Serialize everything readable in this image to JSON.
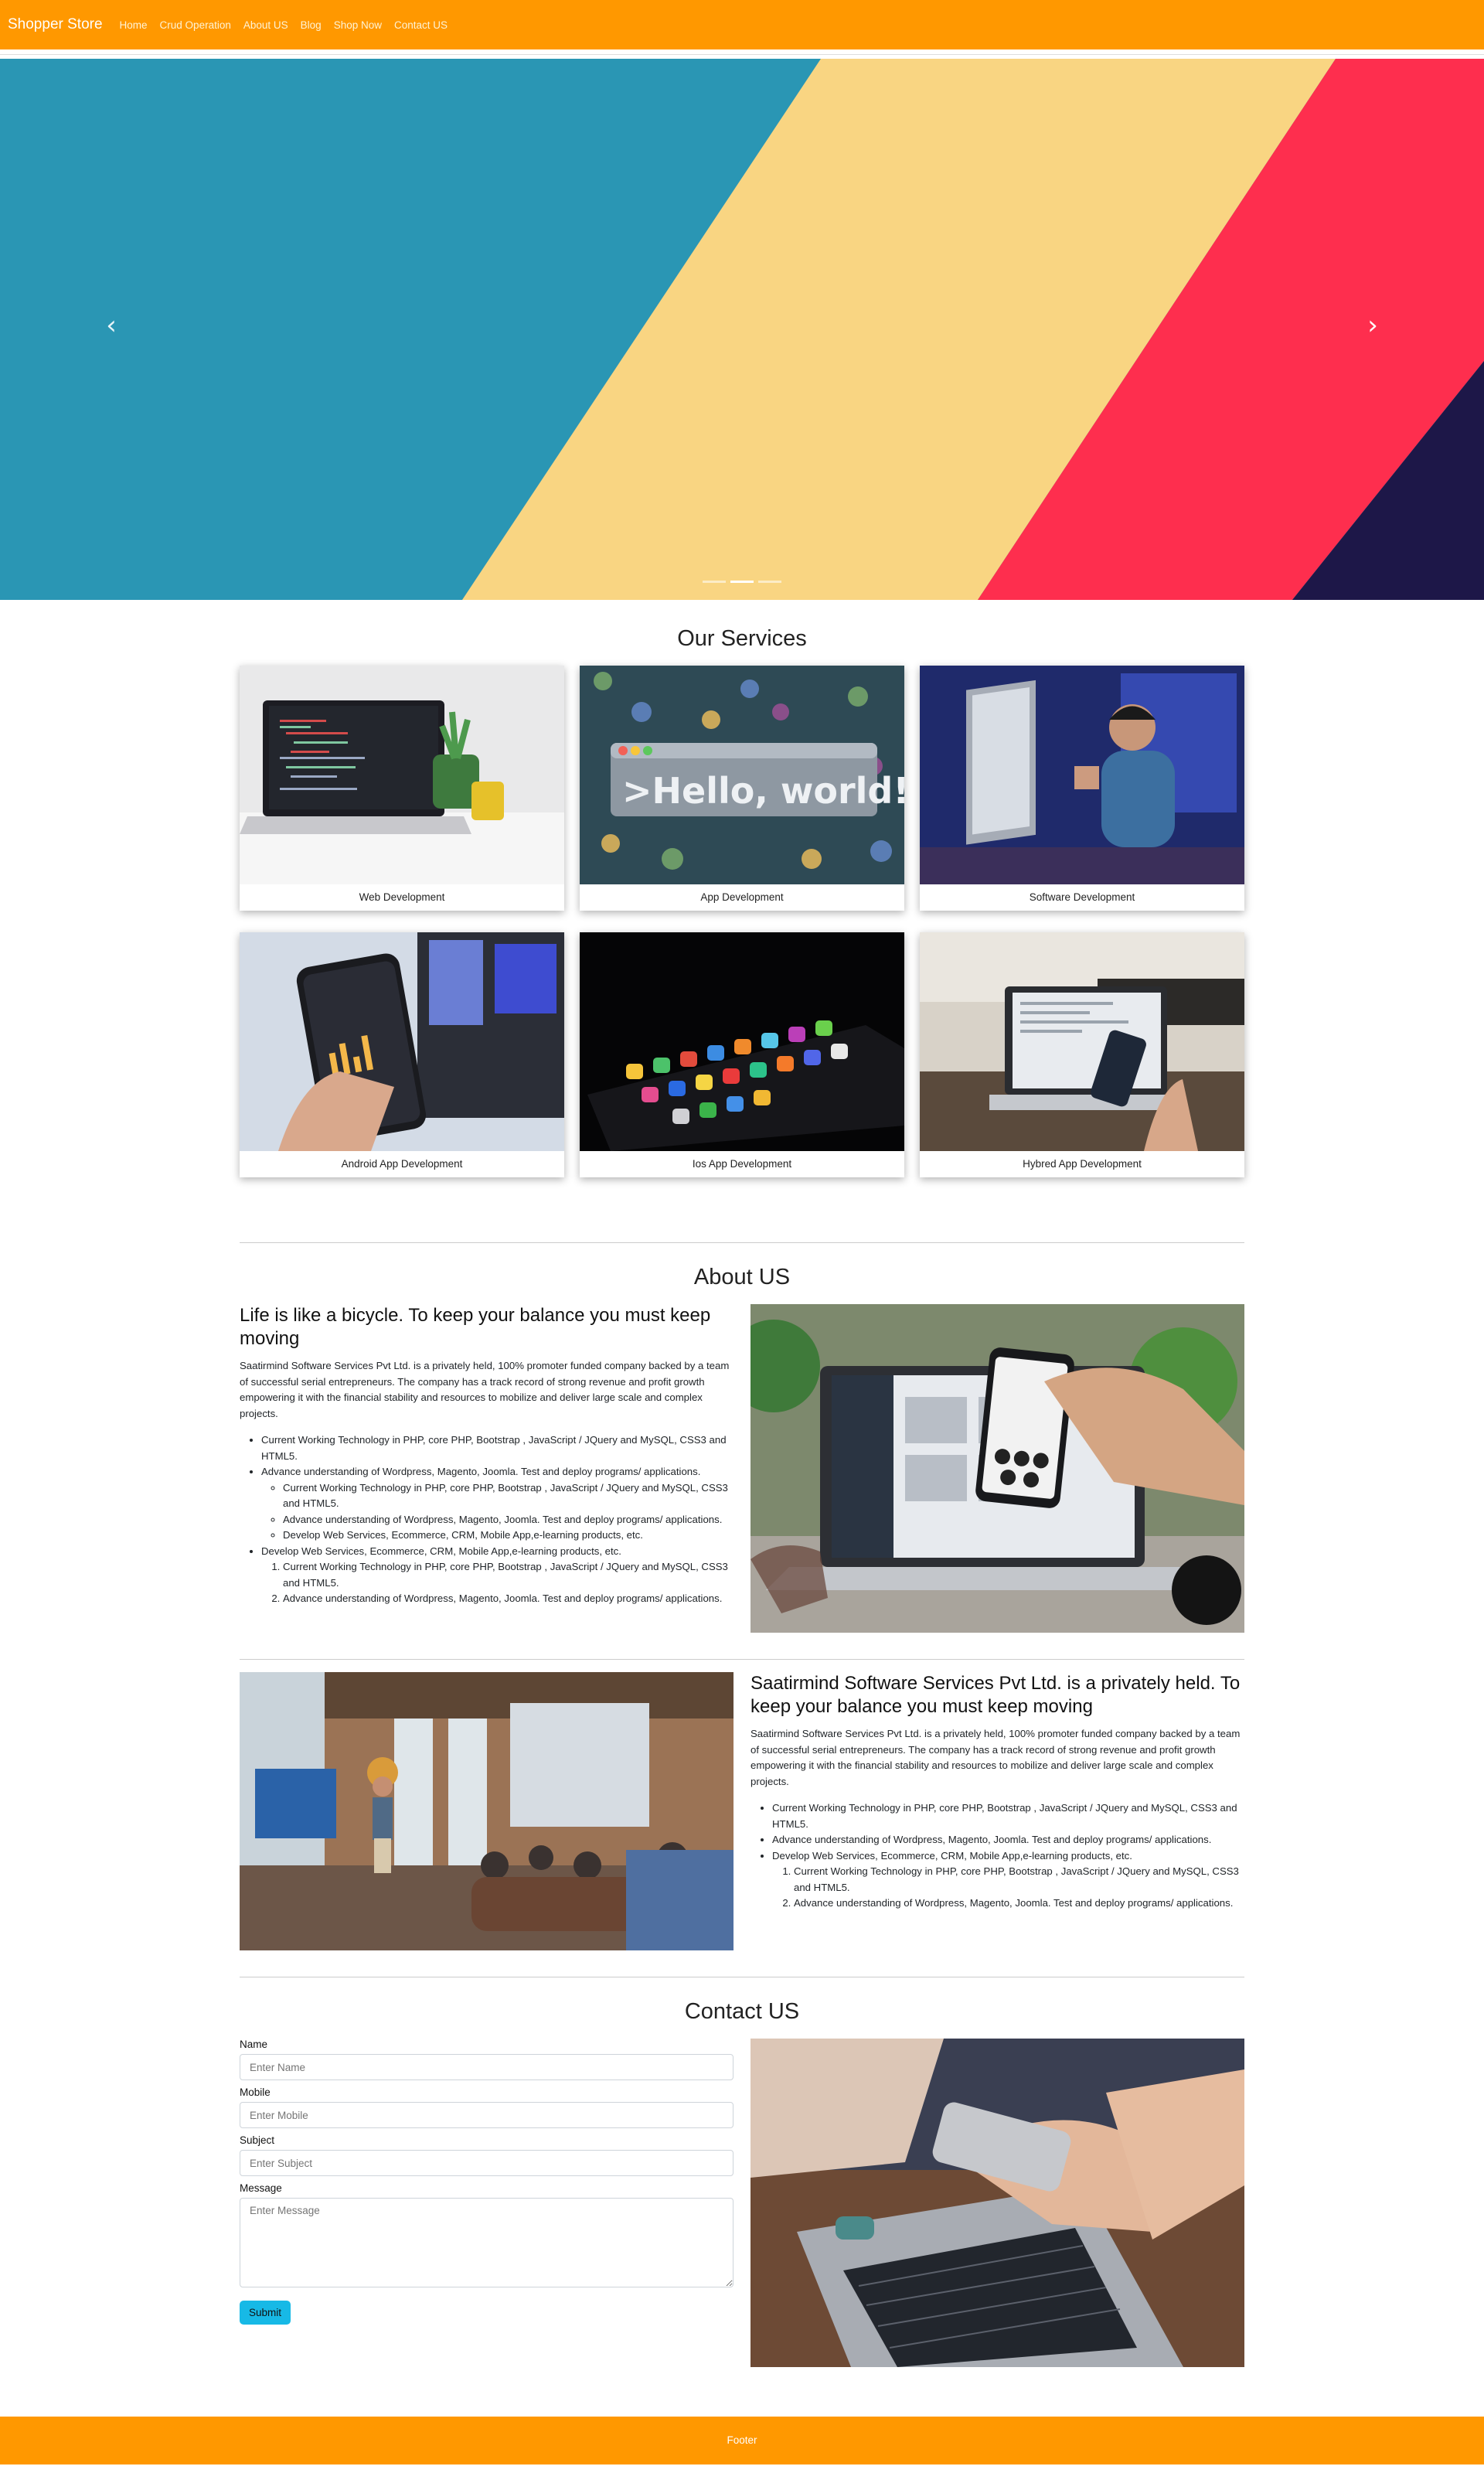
{
  "nav": {
    "brand": "Shopper Store",
    "links": [
      "Home",
      "Crud Operation",
      "About US",
      "Blog",
      "Shop Now",
      "Contact US"
    ]
  },
  "hero": {
    "prev_icon": "chevron-left-icon",
    "next_icon": "chevron-right-icon",
    "slide_count": 3,
    "active_slide": 2,
    "colors": {
      "teal": "#2a96b4",
      "yellow": "#f9d582",
      "red": "#fe2e4e",
      "navy": "#1d1748"
    }
  },
  "services": {
    "title": "Our Services",
    "items": [
      "Web Development",
      "App Development",
      "Software Development",
      "Android App Development",
      "Ios App Development",
      "Hybred App Development"
    ]
  },
  "about": {
    "title": "About US",
    "block1": {
      "heading": "Life is like a bicycle. To keep your balance you must keep moving",
      "paragraph": "Saatirmind Software Services Pvt Ltd. is a privately held, 100% promoter funded company backed by a team of successful serial entrepreneurs. The company has a track record of strong revenue and profit growth empowering it with the financial stability and resources to mobilize and deliver large scale and complex projects.",
      "li1": "Current Working Technology in PHP, core PHP, Bootstrap , JavaScript / JQuery and MySQL, CSS3 and HTML5.",
      "li2": "Advance understanding of Wordpress, Magento, Joomla. Test and deploy programs/ applications.",
      "li2_sub1": "Current Working Technology in PHP, core PHP, Bootstrap , JavaScript / JQuery and MySQL, CSS3 and HTML5.",
      "li2_sub2": "Advance understanding of Wordpress, Magento, Joomla. Test and deploy programs/ applications.",
      "li2_sub3": "Develop Web Services, Ecommerce, CRM, Mobile App,e-learning products, etc.",
      "li3": "Develop Web Services, Ecommerce, CRM, Mobile App,e-learning products, etc.",
      "li3_sub1": "Current Working Technology in PHP, core PHP, Bootstrap , JavaScript / JQuery and MySQL, CSS3 and HTML5.",
      "li3_sub2": "Advance understanding of Wordpress, Magento, Joomla. Test and deploy programs/ applications."
    },
    "block2": {
      "heading": "Saatirmind Software Services Pvt Ltd. is a privately held. To keep your balance you must keep moving",
      "paragraph": "Saatirmind Software Services Pvt Ltd. is a privately held, 100% promoter funded company backed by a team of successful serial entrepreneurs. The company has a track record of strong revenue and profit growth empowering it with the financial stability and resources to mobilize and deliver large scale and complex projects.",
      "li1": "Current Working Technology in PHP, core PHP, Bootstrap , JavaScript / JQuery and MySQL, CSS3 and HTML5.",
      "li2": "Advance understanding of Wordpress, Magento, Joomla. Test and deploy programs/ applications.",
      "li3": "Develop Web Services, Ecommerce, CRM, Mobile App,e-learning products, etc.",
      "li3_sub1": "Current Working Technology in PHP, core PHP, Bootstrap , JavaScript / JQuery and MySQL, CSS3 and HTML5.",
      "li3_sub2": "Advance understanding of Wordpress, Magento, Joomla. Test and deploy programs/ applications."
    }
  },
  "contact": {
    "title": "Contact US",
    "name_label": "Name",
    "name_placeholder": "Enter Name",
    "mobile_label": "Mobile",
    "mobile_placeholder": "Enter Mobile",
    "subject_label": "Subject",
    "subject_placeholder": "Enter Subject",
    "message_label": "Message",
    "message_placeholder": "Enter Message",
    "submit": "Submit"
  },
  "footer": {
    "text": "Footer"
  }
}
